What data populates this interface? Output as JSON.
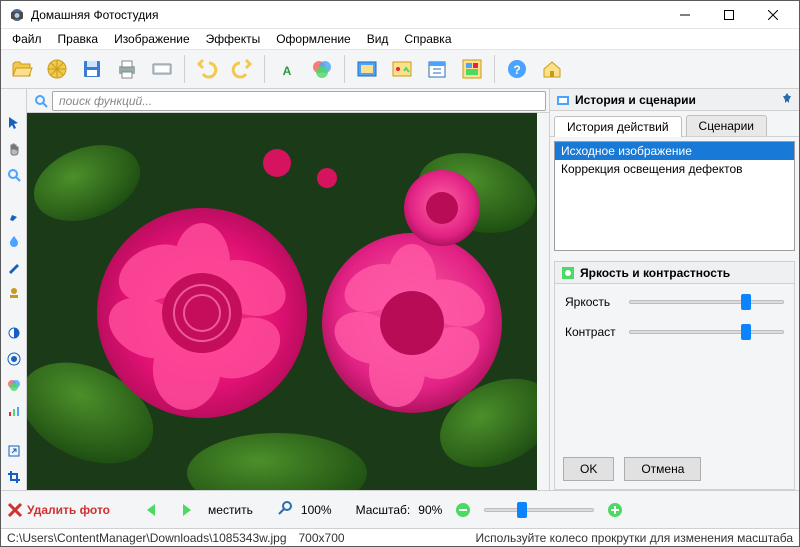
{
  "window": {
    "title": "Домашняя Фотостудия"
  },
  "menu": {
    "items": [
      "Файл",
      "Правка",
      "Изображение",
      "Эффекты",
      "Оформление",
      "Вид",
      "Справка"
    ]
  },
  "search": {
    "placeholder": "поиск функций..."
  },
  "right": {
    "history_panel": "История и сценарии",
    "tab_history": "История действий",
    "tab_scenarios": "Сценарии",
    "history_items": [
      "Исходное изображение",
      "Коррекция освещения дефектов"
    ],
    "bc_panel": "Яркость и контрастность",
    "brightness_label": "Яркость",
    "contrast_label": "Контраст",
    "ok": "OK",
    "cancel": "Отмена"
  },
  "bottom": {
    "delete": "Удалить фото",
    "fit_action": "местить",
    "zoom100": "100%",
    "zoom_label": "Масштаб:",
    "zoom_value": "90%"
  },
  "status": {
    "path": "C:\\Users\\ContentManager\\Downloads\\1085343w.jpg",
    "dims": "700x700",
    "hint": "Используйте колесо прокрутки для изменения масштаба"
  }
}
